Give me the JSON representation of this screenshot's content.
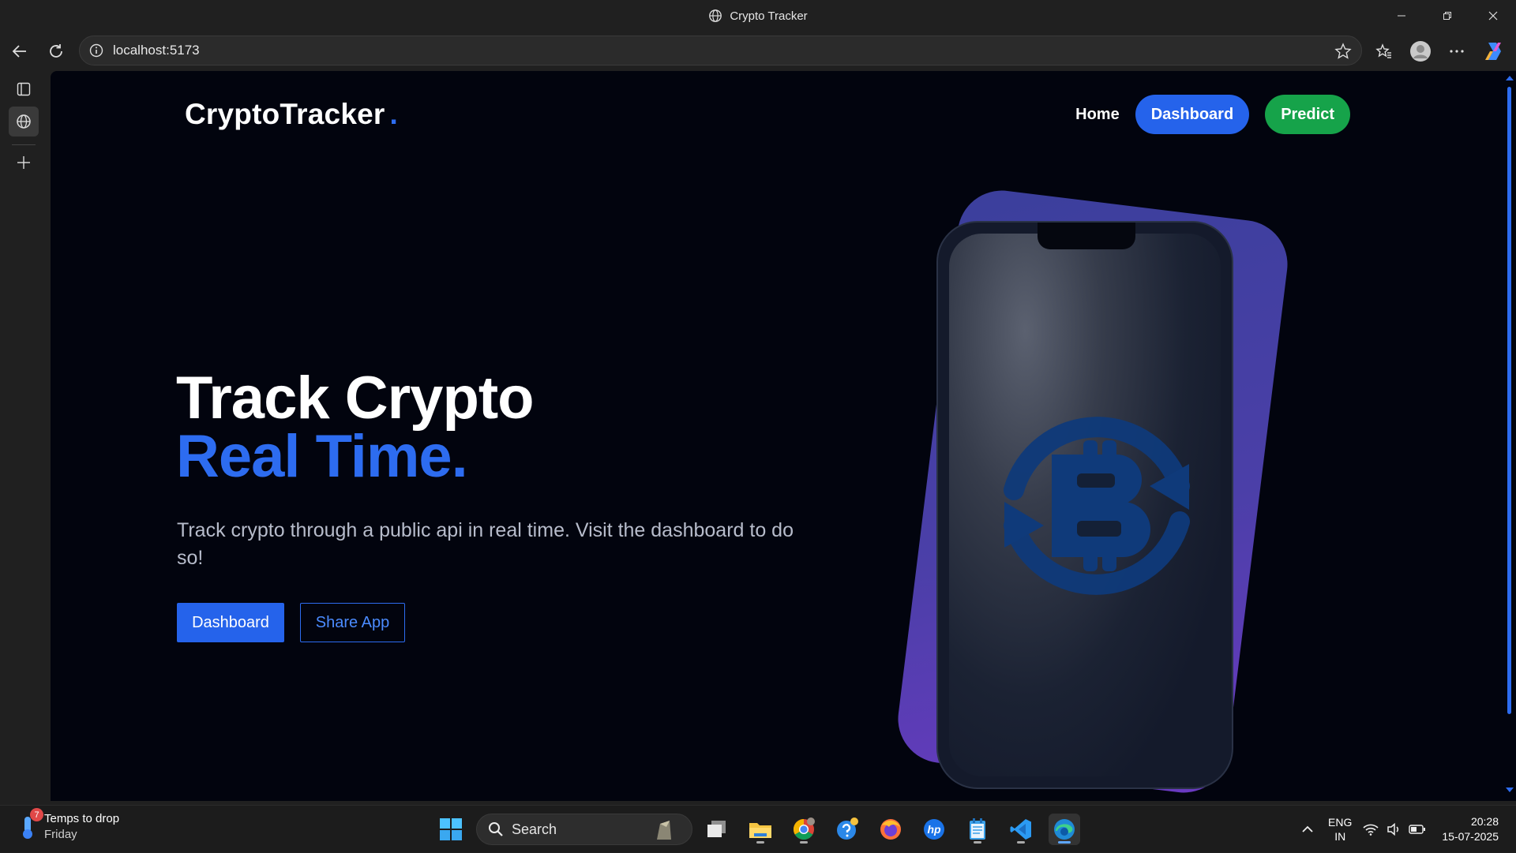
{
  "window": {
    "title": "Crypto Tracker"
  },
  "address_bar": {
    "url": "localhost:5173"
  },
  "page": {
    "brand": "CryptoTracker",
    "brand_dot": ".",
    "nav": {
      "home": "Home",
      "dashboard": "Dashboard",
      "predict": "Predict"
    },
    "hero": {
      "line1": "Track Crypto",
      "line2": "Real Time.",
      "description": "Track crypto through a public api in real time. Visit the dashboard to do so!",
      "primary_button": "Dashboard",
      "secondary_button": "Share App"
    }
  },
  "taskbar": {
    "weather": {
      "title": "Temps to drop",
      "subtitle": "Friday",
      "badge": "7"
    },
    "search_label": "Search",
    "apps": [
      "task-view",
      "file-explorer",
      "chrome",
      "help",
      "firefox",
      "hp",
      "notepad",
      "vscode",
      "edge"
    ],
    "language": {
      "line1": "ENG",
      "line2": "IN"
    },
    "clock": {
      "time": "20:28",
      "date": "15-07-2025"
    }
  },
  "colors": {
    "accent": "#2563eb",
    "predict": "#16a34a",
    "page_bg": "#02040e"
  }
}
